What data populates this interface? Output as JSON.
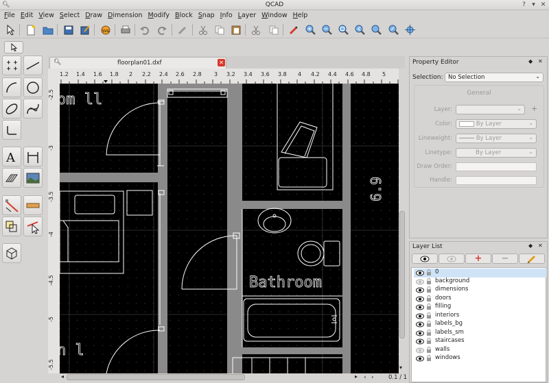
{
  "window": {
    "title": "QCAD"
  },
  "menu": [
    "File",
    "Edit",
    "View",
    "Select",
    "Draw",
    "Dimension",
    "Modify",
    "Block",
    "Snap",
    "Info",
    "Layer",
    "Window",
    "Help"
  ],
  "document": {
    "tab_title": "floorplan01.dxf"
  },
  "rulers": {
    "top": [
      "1.2",
      "1.4",
      "1.6",
      "1.8",
      "2",
      "2.2",
      "2.4",
      "2.6",
      "2.8",
      "3",
      "3.2",
      "3.4",
      "3.6",
      "3.8",
      "4",
      "4.2",
      "4.4",
      "4.6",
      "4.8",
      "5"
    ],
    "left": [
      "-2.5",
      "-3",
      "-3.5",
      "-4",
      "-4.5",
      "-5",
      "-5.5"
    ]
  },
  "drawing": {
    "room_label": "Bathroom",
    "left_text_top": "om ll",
    "left_text_bottom": "n l",
    "dimension_text": "6.9"
  },
  "status": {
    "page": "0.1 / 1"
  },
  "property_editor": {
    "title": "Property Editor",
    "selection_label": "Selection:",
    "selection_value": "No Selection",
    "section": "General",
    "rows": [
      {
        "label": "Layer:",
        "value": ""
      },
      {
        "label": "Color:",
        "value": "By Layer"
      },
      {
        "label": "Lineweight:",
        "value": "By Layer"
      },
      {
        "label": "Linetype:",
        "value": "By Layer"
      },
      {
        "label": "Draw Order:",
        "value": ""
      },
      {
        "label": "Handle:",
        "value": ""
      }
    ]
  },
  "layer_list": {
    "title": "Layer List",
    "layers": [
      {
        "name": "0",
        "visible": true,
        "selected": true
      },
      {
        "name": "background",
        "visible": false
      },
      {
        "name": "dimensions",
        "visible": true
      },
      {
        "name": "doors",
        "visible": true
      },
      {
        "name": "filling",
        "visible": true
      },
      {
        "name": "interiors",
        "visible": true
      },
      {
        "name": "labels_bg",
        "visible": true
      },
      {
        "name": "labels_sm",
        "visible": true
      },
      {
        "name": "staircases",
        "visible": true
      },
      {
        "name": "walls",
        "visible": false
      },
      {
        "name": "windows",
        "visible": true
      }
    ]
  },
  "colors": {
    "canvas": "#000000",
    "wall": "#8a8a8a",
    "selection": "#cfe3f7",
    "accent_red": "#d63a2c"
  }
}
